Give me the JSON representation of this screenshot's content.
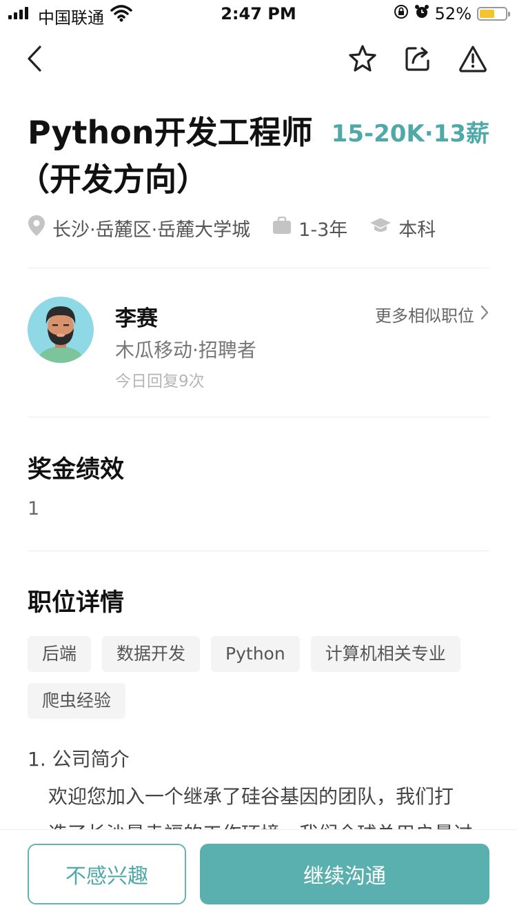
{
  "status_bar": {
    "carrier": "中国联通",
    "time": "2:47 PM",
    "battery": "52%",
    "battery_level": 0.52
  },
  "nav": {
    "icons": [
      "back-icon",
      "star-icon",
      "share-icon",
      "report-icon"
    ]
  },
  "job": {
    "title_line1": "Python开发工程师",
    "title_line2": "（开发方向）",
    "salary": "15-20K·13薪",
    "location": "长沙·岳麓区·岳麓大学城",
    "experience": "1-3年",
    "education": "本科"
  },
  "recruiter": {
    "name": "李赛",
    "company_role": "木瓜移动·招聘者",
    "reply_stat": "今日回复9次",
    "more_link": "更多相似职位"
  },
  "bonus": {
    "heading": "奖金绩效",
    "value": "1"
  },
  "details": {
    "heading": "职位详情",
    "tags": [
      "后端",
      "数据开发",
      "Python",
      "计算机相关专业",
      "爬虫经验"
    ],
    "intro_heading": "1. 公司简介",
    "intro_line1": "欢迎您加入一个继承了硅谷基因的团队，我们打",
    "intro_line2": "造了长沙最幸福的工作环境，我们全球总用户量过"
  },
  "actions": {
    "not_interested": "不感兴趣",
    "continue_chat": "继续沟通"
  },
  "colors": {
    "accent": "#4fa9a9",
    "primary_button": "#5aafaf",
    "battery_fill": "#f4c430"
  }
}
